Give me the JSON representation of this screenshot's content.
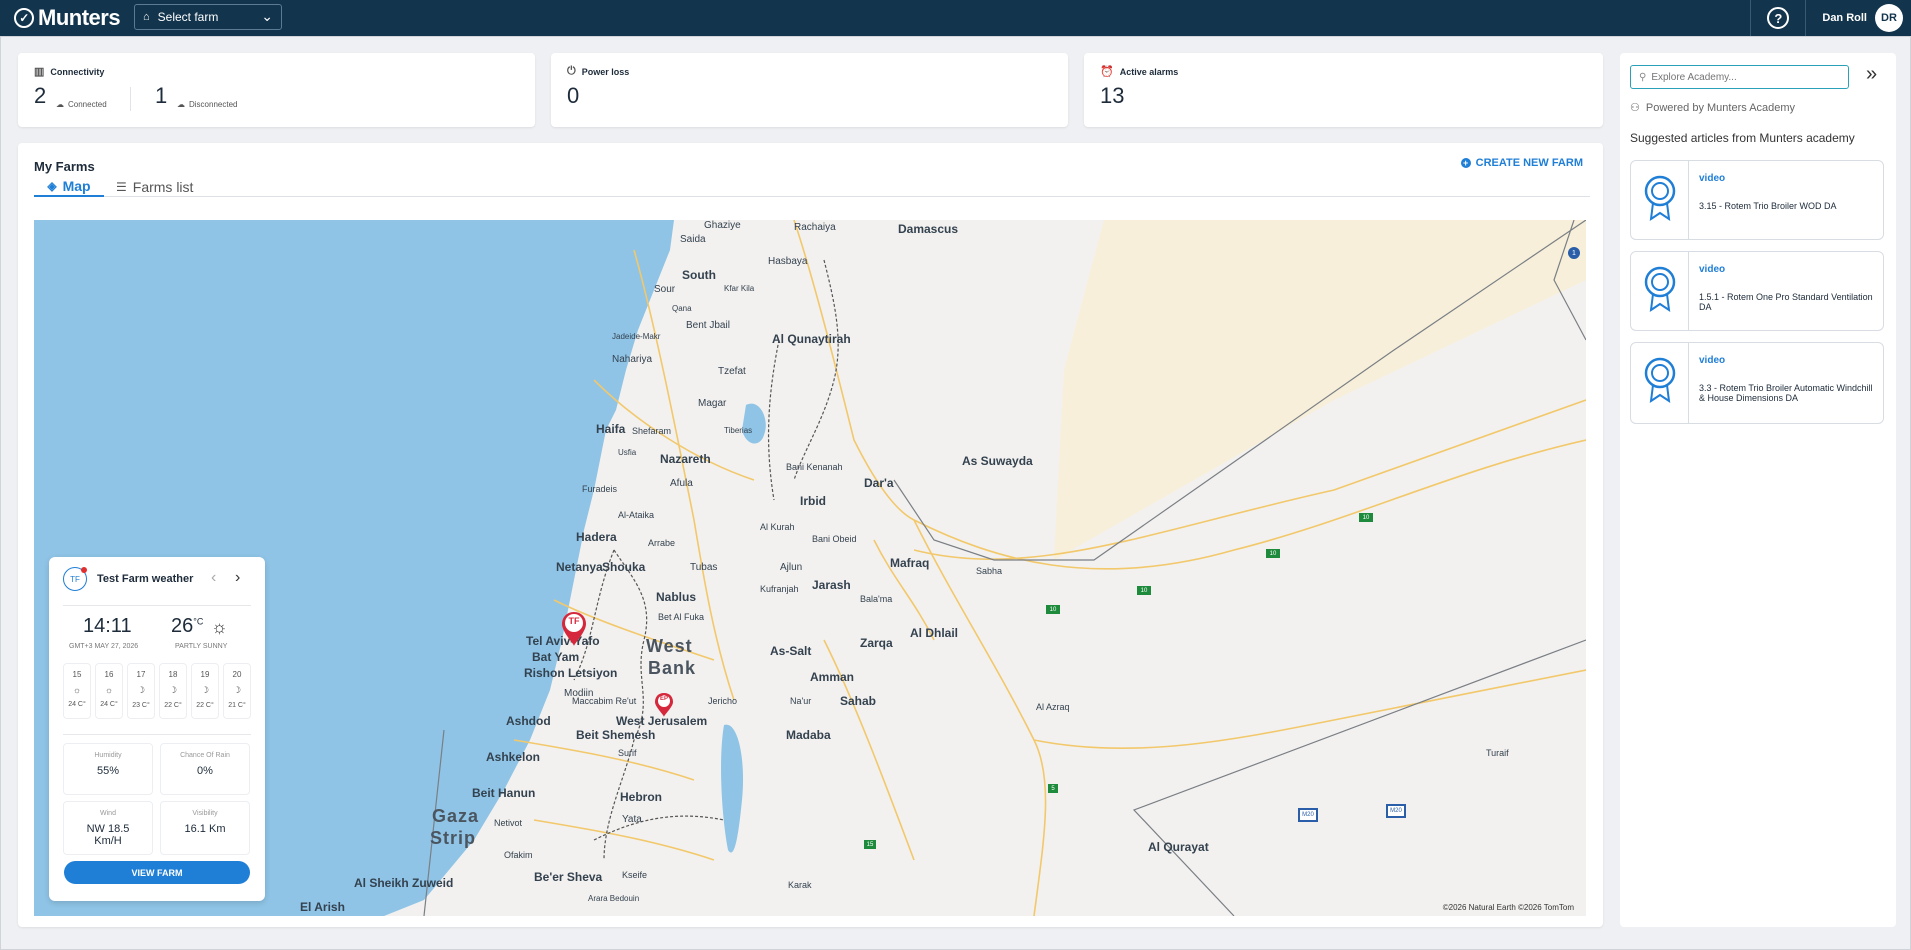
{
  "topbar": {
    "brand": "Munters",
    "farm_select": "Select farm",
    "help_icon": "?",
    "user_name": "Dan Roll",
    "user_initials": "DR"
  },
  "kpis": {
    "connectivity": {
      "title": "Connectivity",
      "connected_value": "2",
      "connected_label": "Connected",
      "disconnected_value": "1",
      "disconnected_label": "Disconnected"
    },
    "power_loss": {
      "title": "Power loss",
      "value": "0"
    },
    "active_alarms": {
      "title": "Active alarms",
      "value": "13"
    }
  },
  "farms": {
    "title": "My Farms",
    "create_label": "CREATE NEW FARM",
    "tabs": [
      {
        "label": "Map",
        "active": true
      },
      {
        "label": "Farms list",
        "active": false
      }
    ]
  },
  "map": {
    "copyright": "©2026 Natural Earth ©2026 TomTom",
    "labels": {
      "ghaziye": "Ghaziye",
      "rachaiya": "Rachaiya",
      "damascus": "Damascus",
      "saida": "Saida",
      "hasbaya": "Hasbaya",
      "south": "South",
      "sour": "Sour",
      "kfar_kila": "Kfar Kila",
      "qana": "Qana",
      "bent_jbail": "Bent Jbail",
      "al_qunaytirah": "Al Qunaytirah",
      "nahariya": "Nahariya",
      "tzefat": "Tzefat",
      "jadeide": "Jadeide-Makr",
      "maghar": "Magar",
      "haifa": "Haifa",
      "shefaram": "Shefaram",
      "tiberias": "Tiberias",
      "usfia": "Usfia",
      "nazareth": "Nazareth",
      "bani_kenanah": "Bani Kenanah",
      "as_suwayda": "As Suwayda",
      "dara": "Dar'a",
      "afula": "Afula",
      "furadeis": "Furadeis",
      "irbid": "Irbid",
      "al_kurah": "Al Kurah",
      "bani_obeid": "Bani Obeid",
      "hadera": "Hadera",
      "arabe": "Arrabe",
      "al_ataika": "Al-Ataika",
      "netanya": "Netanya",
      "shouka": "Shouka",
      "tubas": "Tubas",
      "ajlun": "Ajlun",
      "mafraq": "Mafraq",
      "sabha": "Sabha",
      "jarash": "Jarash",
      "kufranjah": "Kufranjah",
      "nablus": "Nablus",
      "balama": "Bala'ma",
      "bet_al_fuka": "Bet Al Fuka",
      "tel_aviv": "Tel Aviv-Yafo",
      "west_bank_1": "West",
      "west_bank_2": "Bank",
      "al_dhlail": "Al Dhlail",
      "zarqa": "Zarqa",
      "bat_yam": "Bat Yam",
      "as_salt": "As-Salt",
      "rishon": "Rishon Letsiyon",
      "amman": "Amman",
      "modiin": "Modiin",
      "jericho": "Jericho",
      "sahab": "Sahab",
      "maccabim": "Maccabim Re'ut",
      "naur": "Na'ur",
      "ashdod": "Ashdod",
      "west_jerusalem": "West Jerusalem",
      "beit_shemesh": "Beit Shemesh",
      "madaba": "Madaba",
      "al_azraq": "Al Azraq",
      "surif": "Surif",
      "ashkelon": "Ashkelon",
      "beit_hanun": "Beit Hanun",
      "hebron": "Hebron",
      "yata": "Yata",
      "gaza_1": "Gaza",
      "gaza_2": "Strip",
      "netivot": "Netivot",
      "turaif": "Turaif",
      "al_qurayat": "Al Qurayat",
      "ofakim": "Ofakim",
      "beer_sheva": "Be'er Sheva",
      "ksseife": "Kseife",
      "karak": "Karak",
      "al_sheikh_zuweid": "Al Sheikh Zuweid",
      "al_arish": "El Arish",
      "arara": "Arara Bedouin"
    },
    "pins": [
      {
        "label": "TF"
      },
      {
        "label": "EP"
      }
    ],
    "road_badges": {
      "r1": "1",
      "r10a": "10",
      "r10b": "10",
      "r10c": "10",
      "r10d": "10",
      "r5": "5",
      "r15": "15",
      "m20a": "M20",
      "m20b": "M20"
    }
  },
  "weather": {
    "badge": "TF",
    "title": "Test Farm weather",
    "time": "14:11",
    "date": "GMT+3 MAY 27, 2026",
    "temp": "26",
    "temp_unit": "°C",
    "condition": "PARTLY SUNNY",
    "days": [
      {
        "day": "15",
        "icon": "☼",
        "temp": "24 C°"
      },
      {
        "day": "16",
        "icon": "☼",
        "temp": "24 C°"
      },
      {
        "day": "17",
        "icon": "☽",
        "temp": "23 C°"
      },
      {
        "day": "18",
        "icon": "☽",
        "temp": "22 C°"
      },
      {
        "day": "19",
        "icon": "☽",
        "temp": "22 C°"
      },
      {
        "day": "20",
        "icon": "☽",
        "temp": "21 C°"
      }
    ],
    "humidity_label": "Humidity",
    "humidity": "55%",
    "rain_label": "Chance Of Rain",
    "rain": "0%",
    "wind_label": "Wind",
    "wind": "NW 18.5 Km/H",
    "visibility_label": "Visibility",
    "visibility": "16.1 Km",
    "button": "VIEW FARM"
  },
  "academy": {
    "search_placeholder": "Explore Academy...",
    "powered": "Powered by Munters Academy",
    "suggested": "Suggested articles from Munters academy",
    "articles": [
      {
        "kind": "video",
        "name": "3.15 - Rotem Trio Broiler WOD DA"
      },
      {
        "kind": "video",
        "name": "1.5.1 - Rotem One Pro Standard Ventilation DA"
      },
      {
        "kind": "video",
        "name": "3.3 - Rotem Trio Broiler Automatic Windchill & House Dimensions DA"
      }
    ]
  },
  "colors": {
    "topbar": "#12344d",
    "accent": "#1f7ed6",
    "sea": "#8fc4e6",
    "pin": "#d5283c"
  }
}
